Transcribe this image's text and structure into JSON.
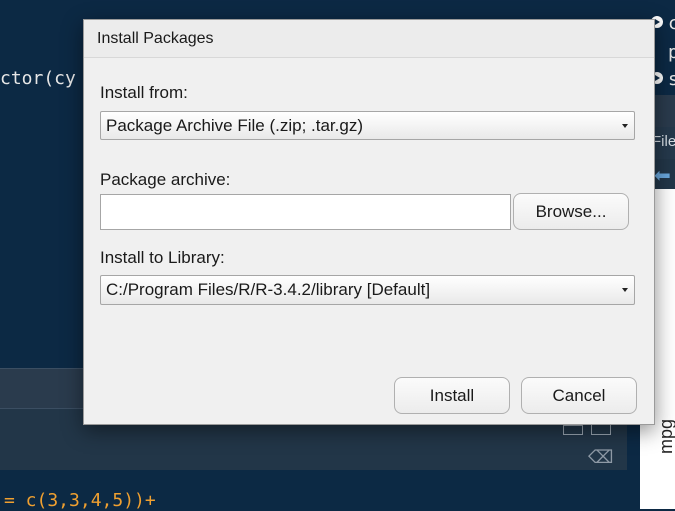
{
  "background": {
    "editor_code_fragment": "ctor(cy",
    "console_code_fragment": "= c(3,3,4,5))+",
    "right_panel_tab_fragment": "File",
    "right_panel_plot_label": "mpg",
    "right_top_letters": [
      "c",
      "p",
      "s"
    ]
  },
  "dialog": {
    "title": "Install Packages",
    "install_from_label": "Install from:",
    "install_from_value": "Package Archive File (.zip; .tar.gz)",
    "package_archive_label": "Package archive:",
    "package_archive_value": "",
    "browse_label": "Browse...",
    "install_to_label": "Install to Library:",
    "install_to_value": "C:/Program Files/R/R-3.4.2/library [Default]",
    "install_button": "Install",
    "cancel_button": "Cancel"
  },
  "colors": {
    "ide_background": "#0c2944",
    "dialog_background": "#f0f0f0",
    "code_orange": "#f0a030"
  }
}
